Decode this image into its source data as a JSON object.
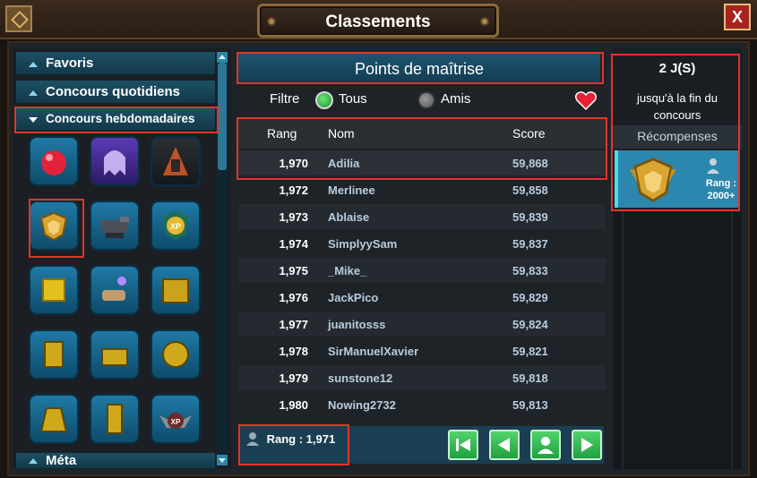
{
  "window": {
    "title": "Classements",
    "close_label": "X"
  },
  "sidebar": {
    "categories": [
      {
        "label": "Favoris"
      },
      {
        "label": "Concours quotidiens"
      },
      {
        "label": "Concours hebdomadaires"
      },
      {
        "label": "Méta"
      }
    ],
    "icons": [
      "red-gem-icon",
      "ghost-icon",
      "boss-icon",
      "shield-badge-icon",
      "robot-tank-icon",
      "xp-shield-icon",
      "gold-cube-icon",
      "magic-hand-icon",
      "gold-machine-icon",
      "gold-robot-icon",
      "gold-tank-icon",
      "gold-mech-icon",
      "gold-creature-icon",
      "gold-tower-icon",
      "xp-wings-icon"
    ]
  },
  "main": {
    "header": "Points de maîtrise",
    "filter": {
      "label": "Filtre",
      "options": [
        {
          "label": "Tous",
          "selected": true
        },
        {
          "label": "Amis",
          "selected": false
        }
      ]
    },
    "table": {
      "columns": [
        "Rang",
        "Nom",
        "Score"
      ],
      "rows": [
        {
          "rank": "1,970",
          "name": "Adilia",
          "score": "59,868"
        },
        {
          "rank": "1,972",
          "name": "Merlinee",
          "score": "59,858"
        },
        {
          "rank": "1,973",
          "name": "Ablaise",
          "score": "59,839"
        },
        {
          "rank": "1,974",
          "name": "SimplyySam",
          "score": "59,837"
        },
        {
          "rank": "1,975",
          "name": "_Mike_",
          "score": "59,833"
        },
        {
          "rank": "1,976",
          "name": "JackPico",
          "score": "59,829"
        },
        {
          "rank": "1,977",
          "name": "juanitosss",
          "score": "59,824"
        },
        {
          "rank": "1,978",
          "name": "SirManuelXavier",
          "score": "59,821"
        },
        {
          "rank": "1,979",
          "name": "sunstone12",
          "score": "59,818"
        },
        {
          "rank": "1,980",
          "name": "Nowing2732",
          "score": "59,813"
        }
      ]
    },
    "my_rank": "Rang : 1,971"
  },
  "side": {
    "days": "2 J(S)",
    "until_line1": "jusqu'à la fin du",
    "until_line2": "concours",
    "rewards_label": "Récompenses",
    "reward_tier_line1": "Rang :",
    "reward_tier_line2": "2000+"
  },
  "colors": {
    "accent_teal": "#1d5470",
    "highlight_red": "#e1352a",
    "button_green": "#20a03f"
  }
}
